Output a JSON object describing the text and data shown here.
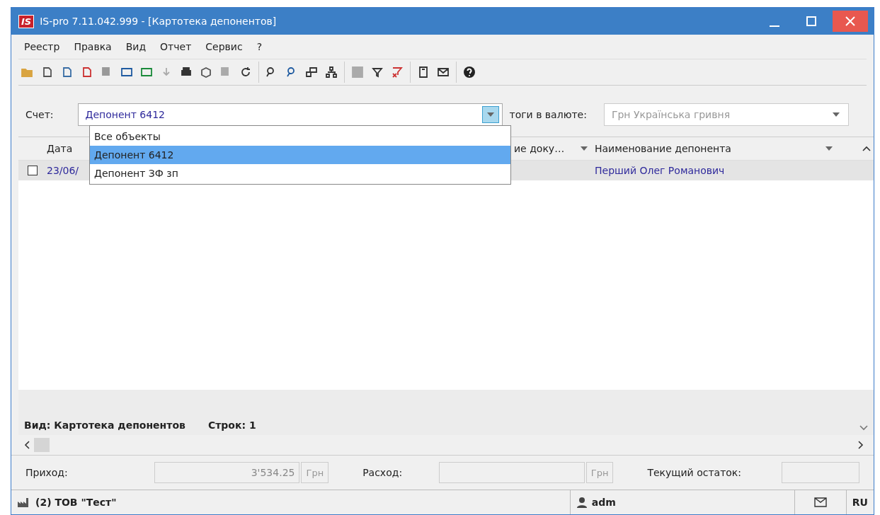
{
  "window": {
    "logo": "IS",
    "title": "IS-pro 7.11.042.999 - [Картотека депонентов]"
  },
  "menu": [
    "Реестр",
    "Правка",
    "Вид",
    "Отчет",
    "Сервис",
    "?"
  ],
  "filter": {
    "account_label": "Счет:",
    "account_value": "Депонент 6412",
    "currency_label": "тоги в валюте:",
    "currency_value": "Грн Українська гривня",
    "currency_disabled": true
  },
  "dropdown": [
    {
      "label": "Все объекты",
      "selected": false
    },
    {
      "label": "Депонент 6412",
      "selected": true
    },
    {
      "label": "Депонент ЗФ зп",
      "selected": false
    }
  ],
  "table": {
    "columns": [
      "Дата",
      "ие доку…",
      "Наименование депонента"
    ],
    "rows": [
      {
        "checked": false,
        "selected": true,
        "cells": [
          "23/06/",
          "",
          "Перший Олег Романович"
        ]
      }
    ]
  },
  "summary": {
    "view": "Вид: Картотека депонентов",
    "rows": "Строк: 1"
  },
  "totals": {
    "income_label": "Приход:",
    "income_value": "3'534.25",
    "income_unit": "Грн",
    "expense_label": "Расход:",
    "expense_unit": "Грн",
    "balance_label": "Текущий остаток:"
  },
  "status_bar": {
    "company": "(2) ТОВ \"Тест\"",
    "user": "adm",
    "language": "RU"
  }
}
